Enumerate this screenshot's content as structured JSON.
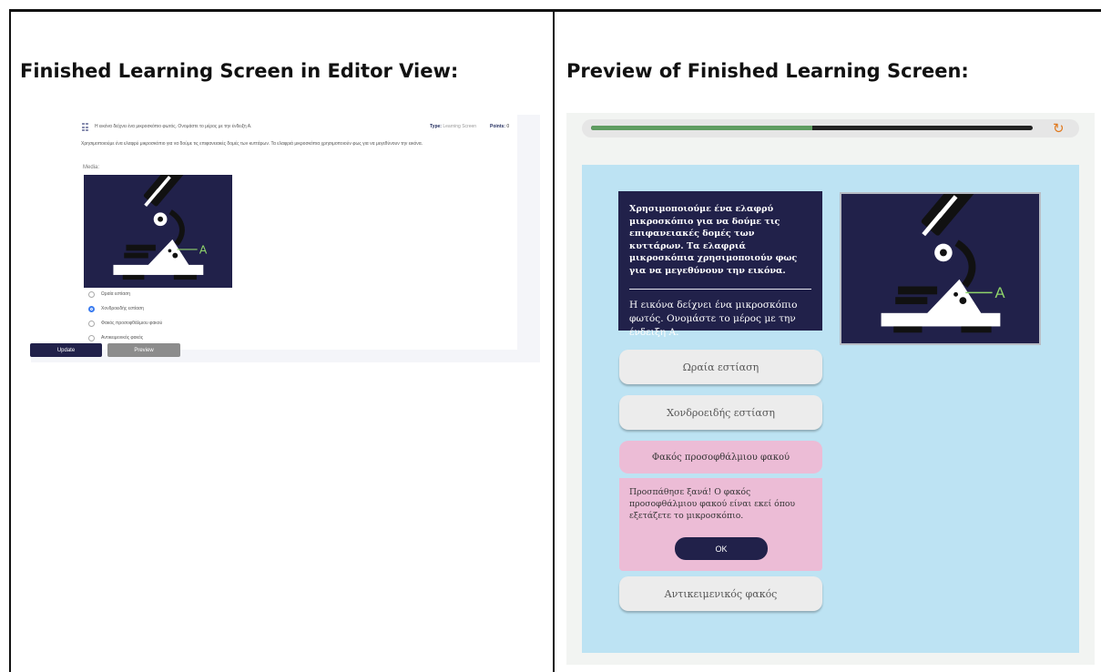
{
  "table": {
    "left_title": "Finished Learning Screen in Editor View:",
    "right_title": "Preview of Finished Learning Screen:"
  },
  "editor": {
    "question_text": "Η εικόνα δείχνει ένα μικροσκόπιο φωτός. Ονομάστε το μέρος με την ένδειξη Α.",
    "type_label": "Type:",
    "type_value": "Learning Screen",
    "points_label": "Points:",
    "points_value": "0",
    "description": "Χρησιμοποιούμε ένα ελαφρύ μικροσκόπιο για να δούμε τις επιφανειακές δομές των κυττάρων. Τα ελαφριά μικροσκόπια χρησιμοποιούν φως για να μεγεθύνουν την εικόνα.",
    "media_label": "Media:",
    "media_annotation": "A",
    "options": [
      {
        "label": "Ωραία εστίαση",
        "selected": false
      },
      {
        "label": "Χονδροειδής εστίαση",
        "selected": true
      },
      {
        "label": "Φακός προσοφθάλμιου φακού",
        "selected": false
      },
      {
        "label": "Αντικειμενικός φακός",
        "selected": false
      }
    ],
    "update_button": "Update",
    "preview_button": "Preview"
  },
  "preview": {
    "progress_fraction": 0.5,
    "colors": {
      "navy": "#21214a",
      "panel_bg": "#bde3f3",
      "progress_fill": "#5f9c61",
      "wrong_bg": "#ecbcd6",
      "restart_icon": "#e07a1f"
    },
    "restart_icon": "restart-icon",
    "description": "Χρησιμοποιούμε ένα ελαφρύ μικροσκόπιο για να δούμε τις επιφανειακές δομές των κυττάρων. Τα ελαφριά μικροσκόπια χρησιμοποιούν φως για να μεγεθύνουν την εικόνα.",
    "question": "Η εικόνα δείχνει ένα μικροσκόπιο φωτός. Ονομάστε το μέρος με την ένδειξη Α.",
    "media_annotation": "A",
    "choices": [
      "Ωραία εστίαση",
      "Χονδροειδής εστίαση",
      "Φακός προσοφθάλμιου φακού",
      "Αντικειμενικός φακός"
    ],
    "wrong_choice_index": 2,
    "feedback": "Προσπάθησε ξανά! Ο φακός προσοφθάλμιου φακού είναι εκεί όπου εξετάζετε το μικροσκόπιο.",
    "ok_button": "OK"
  }
}
